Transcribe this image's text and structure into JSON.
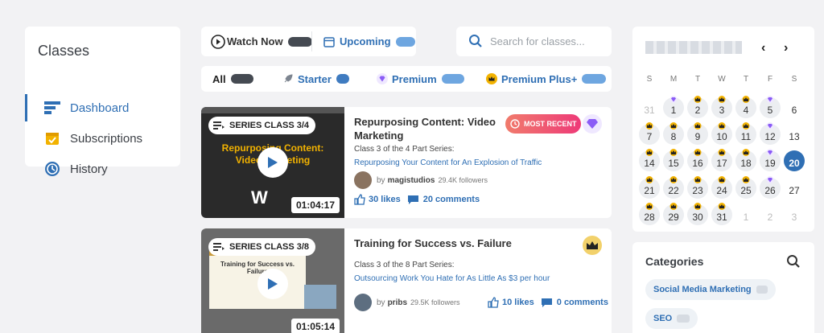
{
  "sidebar": {
    "title": "Classes",
    "items": [
      {
        "label": "Dashboard",
        "icon": "dashboard-icon",
        "active": true
      },
      {
        "label": "Subscriptions",
        "icon": "calendar-check-icon",
        "active": false
      },
      {
        "label": "History",
        "icon": "history-icon",
        "active": false
      }
    ]
  },
  "tabs": {
    "watch_now": "Watch Now",
    "upcoming": "Upcoming"
  },
  "search": {
    "placeholder": "Search for classes..."
  },
  "filters": {
    "all": "All",
    "starter": "Starter",
    "premium": "Premium",
    "premium_plus": "Premium Plus+"
  },
  "classes": [
    {
      "series": "SERIES CLASS 3/4",
      "thumb_text": "Repurposing Content: Video Marketing",
      "duration": "01:04:17",
      "title": "Repurposing Content: Video Marketing",
      "sub1": "Class 3 of the 4 Part Series:",
      "sub2": "Repurposing Your Content for An Explosion of Traffic",
      "by": "by",
      "author": "magistudios",
      "followers": "29.4K followers",
      "likes": "30 likes",
      "comments": "20 comments",
      "badge": "MOST RECENT"
    },
    {
      "series": "SERIES CLASS 3/8",
      "thumb_text": "Training for Success vs. Failure",
      "duration": "01:05:14",
      "title": "Training for Success vs. Failure",
      "sub1": "Class 3 of the 8 Part Series:",
      "sub2": "Outsourcing Work You Hate for As Little As $3 per hour",
      "by": "by",
      "author": "pribs",
      "followers": "29.5K followers",
      "likes": "10 likes",
      "comments": "0 comments"
    }
  ],
  "calendar": {
    "prev": "‹",
    "next": "›",
    "weekdays": [
      "S",
      "M",
      "T",
      "W",
      "T",
      "F",
      "S"
    ],
    "rows": [
      [
        "31",
        "1",
        "2",
        "3",
        "4",
        "5",
        "6"
      ],
      [
        "7",
        "8",
        "9",
        "10",
        "11",
        "12",
        "13"
      ],
      [
        "14",
        "15",
        "16",
        "17",
        "18",
        "19",
        "20"
      ],
      [
        "21",
        "22",
        "23",
        "24",
        "25",
        "26",
        "27"
      ],
      [
        "28",
        "29",
        "30",
        "31",
        "1",
        "2",
        "3"
      ]
    ],
    "today": "20"
  },
  "categories": {
    "title": "Categories",
    "chips": [
      "Social Media Marketing",
      "SEO"
    ]
  },
  "colors": {
    "accent": "#2f6fb4",
    "premium": "#8b5cf6",
    "crown": "#f2b200",
    "most_recent_start": "#f07b6c",
    "most_recent_end": "#ee3a78"
  }
}
